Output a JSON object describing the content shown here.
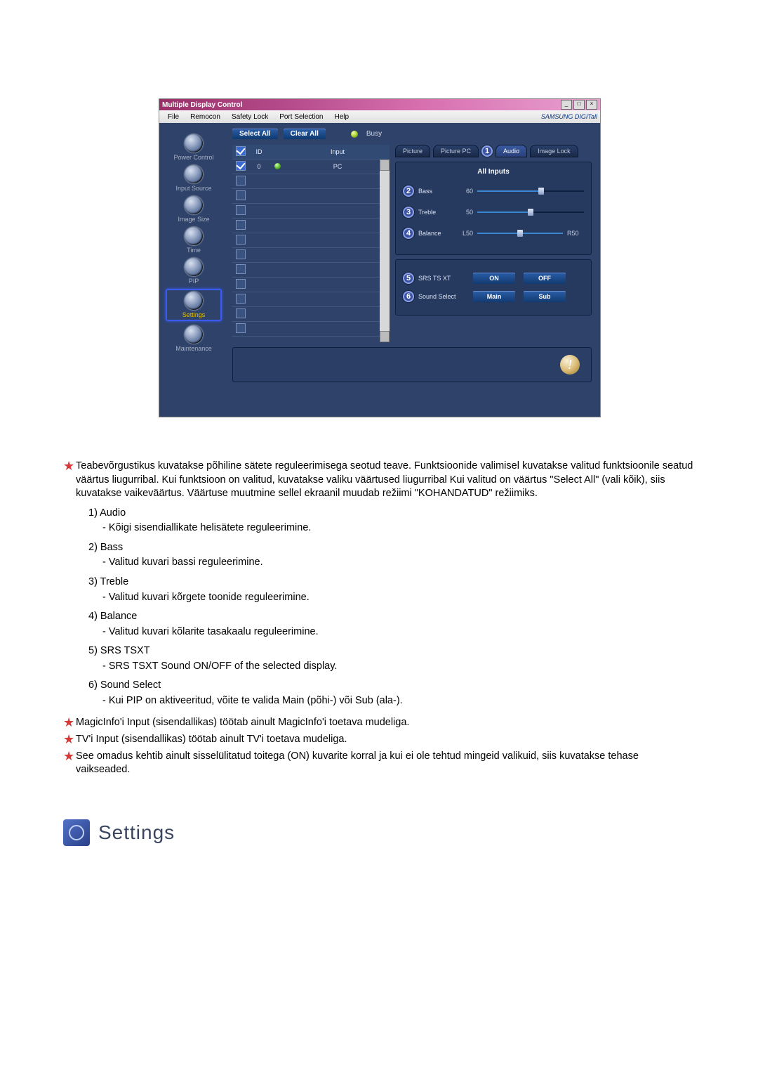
{
  "window": {
    "title": "Multiple Display Control",
    "menu": [
      "File",
      "Remocon",
      "Safety Lock",
      "Port Selection",
      "Help"
    ],
    "brand": "SAMSUNG DIGITall"
  },
  "sidebar": {
    "items": [
      {
        "label": "Power Control"
      },
      {
        "label": "Input Source"
      },
      {
        "label": "Image Size"
      },
      {
        "label": "Time"
      },
      {
        "label": "PIP"
      },
      {
        "label": "Settings"
      },
      {
        "label": "Maintenance"
      }
    ]
  },
  "toolbar": {
    "select_all": "Select All",
    "clear_all": "Clear All",
    "busy_label": "Busy"
  },
  "grid": {
    "headers": {
      "chk": "☑",
      "id": "ID",
      "status": "",
      "input": "Input"
    },
    "first_row": {
      "id": "0",
      "input": "PC"
    }
  },
  "tabs": [
    "Picture",
    "Picture PC",
    "Audio",
    "Image Lock"
  ],
  "audio": {
    "panel_title": "All Inputs",
    "bass": {
      "label": "Bass",
      "value": "60",
      "pct": 60
    },
    "treble": {
      "label": "Treble",
      "value": "50",
      "pct": 50
    },
    "balance": {
      "label": "Balance",
      "left": "L50",
      "right": "R50",
      "pct": 50
    },
    "srs": {
      "label": "SRS TS XT",
      "on": "ON",
      "off": "OFF"
    },
    "sound_select": {
      "label": "Sound Select",
      "main": "Main",
      "sub": "Sub"
    }
  },
  "callouts": {
    "c1": "1",
    "c2": "2",
    "c3": "3",
    "c4": "4",
    "c5": "5",
    "c6": "6"
  },
  "text": {
    "p1": "Teabevõrgustikus kuvatakse põhiline sätete reguleerimisega seotud teave. Funktsioonide valimisel kuvatakse valitud funktsioonile seatud väärtus liugurribal. Kui funktsioon on valitud, kuvatakse valiku väärtused liugurribal Kui valitud on väärtus \"Select All\" (vali kõik), siis kuvatakse vaikeväärtus. Väärtuse muutmine sellel ekraanil muudab režiimi \"KOHANDATUD\" režiimiks.",
    "n1_head": "1) Audio",
    "n1_sub": "- Kõigi sisendiallikate helisätete reguleerimine.",
    "n2_head": "2) Bass",
    "n2_sub": "- Valitud kuvari bassi reguleerimine.",
    "n3_head": "3) Treble",
    "n3_sub": "- Valitud kuvari kõrgete toonide reguleerimine.",
    "n4_head": "4) Balance",
    "n4_sub": "- Valitud kuvari kõlarite tasakaalu reguleerimine.",
    "n5_head": "5) SRS TSXT",
    "n5_sub": "- SRS TSXT Sound ON/OFF of the selected display.",
    "n6_head": "6) Sound Select",
    "n6_sub": "- Kui PIP on aktiveeritud, võite te valida Main (põhi-) või Sub (ala-).",
    "p2": "MagicInfo'i Input (sisendallikas) töötab ainult MagicInfo'i toetava mudeliga.",
    "p3": "TV'i Input (sisendallikas) töötab ainult TV'i toetava mudeliga.",
    "p4": "See omadus kehtib ainult sisselülitatud toitega (ON) kuvarite korral ja kui ei ole tehtud mingeid valikuid, siis kuvatakse tehase vaikseaded."
  },
  "heading": {
    "settings": "Settings"
  }
}
